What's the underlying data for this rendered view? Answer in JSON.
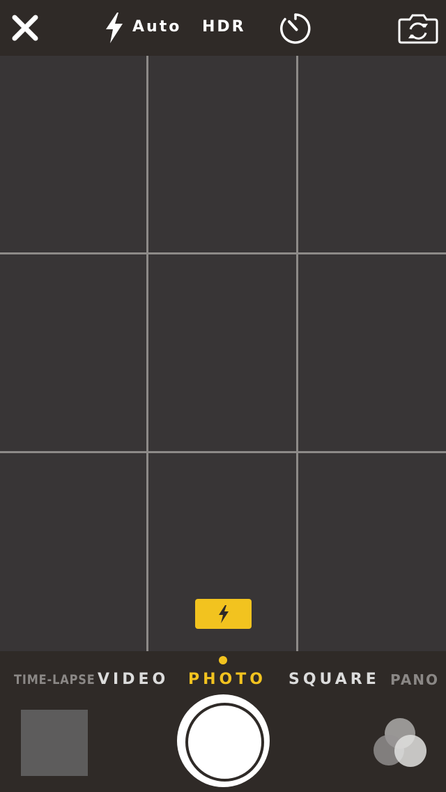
{
  "topbar": {
    "close_icon": "close-icon",
    "flash_icon": "lightning-bolt-icon",
    "flash_label": "Auto",
    "hdr_label": "HDR",
    "timer_icon": "timer-icon",
    "switch_camera_icon": "camera-switch-icon"
  },
  "viewfinder": {
    "grid": "3x3",
    "flash_indicator_icon": "lightning-bolt-icon"
  },
  "modes": {
    "items": [
      "TIME-LAPSE",
      "VIDEO",
      "PHOTO",
      "SQUARE",
      "PANO"
    ],
    "selected": "PHOTO"
  },
  "controls": {
    "thumbnail_icon": "last-photo-thumbnail",
    "shutter_icon": "shutter-button",
    "filters_icon": "filters-icon"
  },
  "colors": {
    "accent": "#f2c31f",
    "bar_background": "#2f2a27",
    "viewfinder_background": "#383536",
    "grid_line": "#8d8a88"
  }
}
